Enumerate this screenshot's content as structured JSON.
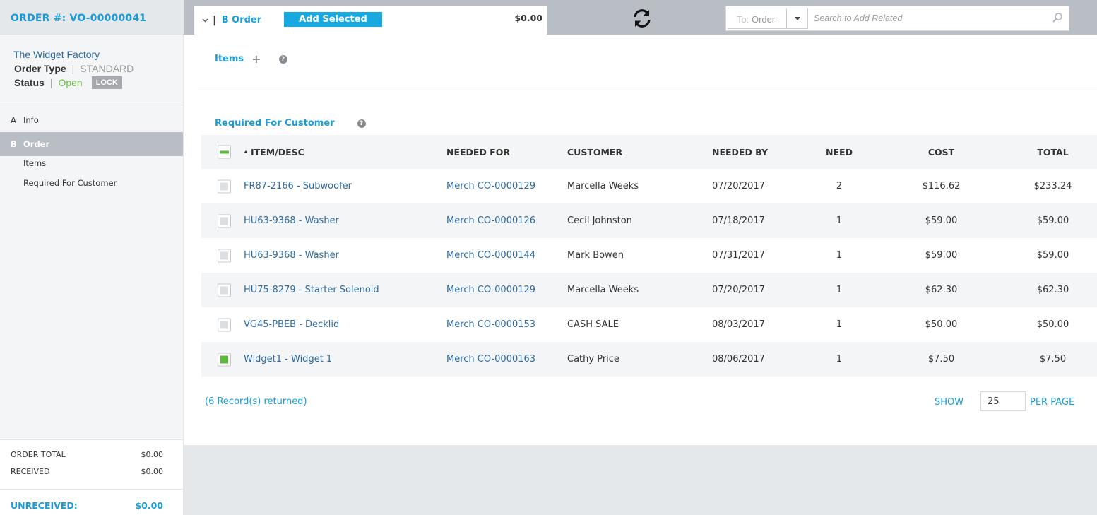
{
  "sidebar": {
    "order_number": "ORDER #: VO-00000041",
    "company": "The Widget Factory",
    "order_type_label": "Order Type",
    "order_type_value": "STANDARD",
    "status_label": "Status",
    "status_value": "Open",
    "lock_label": "LOCK",
    "nav": [
      {
        "letter": "A",
        "label": "Info"
      },
      {
        "letter": "B",
        "label": "Order"
      }
    ],
    "sub_items": [
      "Items",
      "Required For Customer"
    ],
    "totals": {
      "order_total_label": "ORDER TOTAL",
      "order_total_value": "$0.00",
      "received_label": "RECEIVED",
      "received_value": "$0.00",
      "unreceived_label": "UNRECEIVED:",
      "unreceived_value": "$0.00"
    }
  },
  "topbar": {
    "tab_pipe": "|",
    "tab_title": "B Order",
    "add_selected_label": "Add Selected",
    "tab_amount": "$0.00",
    "to_prefix": "To:",
    "to_value": "Order",
    "search_placeholder": "Search to Add Related"
  },
  "main": {
    "items_label": "Items",
    "items_plus": "+",
    "help_glyph": "?",
    "rfc_label": "Required For Customer",
    "columns": {
      "item": "ITEM/DESC",
      "needed_for": "NEEDED FOR",
      "customer": "CUSTOMER",
      "needed_by": "NEEDED BY",
      "need": "NEED",
      "cost": "COST",
      "total": "TOTAL"
    },
    "rows": [
      {
        "item": "FR87-2166 - Subwoofer",
        "needed_for": "Merch CO-0000129",
        "customer": "Marcella Weeks",
        "needed_by": "07/20/2017",
        "need": "2",
        "cost": "$116.62",
        "total": "$233.24",
        "checked": false
      },
      {
        "item": "HU63-9368 - Washer",
        "needed_for": "Merch CO-0000126",
        "customer": "Cecil Johnston",
        "needed_by": "07/18/2017",
        "need": "1",
        "cost": "$59.00",
        "total": "$59.00",
        "checked": false
      },
      {
        "item": "HU63-9368 - Washer",
        "needed_for": "Merch CO-0000144",
        "customer": "Mark Bowen",
        "needed_by": "07/31/2017",
        "need": "1",
        "cost": "$59.00",
        "total": "$59.00",
        "checked": false
      },
      {
        "item": "HU75-8279 - Starter Solenoid",
        "needed_for": "Merch CO-0000129",
        "customer": "Marcella Weeks",
        "needed_by": "07/20/2017",
        "need": "1",
        "cost": "$62.30",
        "total": "$62.30",
        "checked": false
      },
      {
        "item": "VG45-PBEB - Decklid",
        "needed_for": "Merch CO-0000153",
        "customer": "CASH SALE",
        "needed_by": "08/03/2017",
        "need": "1",
        "cost": "$50.00",
        "total": "$50.00",
        "checked": false
      },
      {
        "item": "Widget1 - Widget 1",
        "needed_for": "Merch CO-0000163",
        "customer": "Cathy Price",
        "needed_by": "08/06/2017",
        "need": "1",
        "cost": "$7.50",
        "total": "$7.50",
        "checked": true
      }
    ],
    "records_text": "(6 Record(s) returned)",
    "show_label": "SHOW",
    "per_page_value": "25",
    "per_page_label": "PER PAGE"
  },
  "colors": {
    "accent_blue": "#1a9ad6",
    "link_blue": "#2e6aa0",
    "green": "#5cba3c",
    "topbar_gray": "#b9bec4"
  }
}
